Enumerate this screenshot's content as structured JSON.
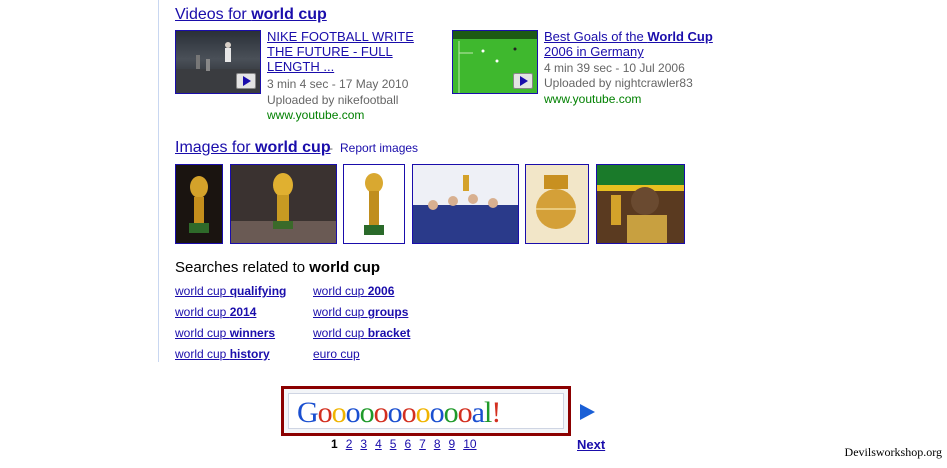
{
  "videos": {
    "title_prefix": "Videos for ",
    "title_query": "world cup",
    "items": [
      {
        "title": "NIKE FOOTBALL WRITE THE FUTURE - FULL LENGTH ...",
        "meta": "3 min 4 sec - 17 May 2010",
        "uploader": "Uploaded by nikefootball",
        "url": "www.youtube.com"
      },
      {
        "title_prefix": "Best Goals of the ",
        "title_bold": "World Cup",
        "title_suffix": " 2006 in Germany",
        "meta": "4 min 39 sec - 10 Jul 2006",
        "uploader": "Uploaded by nightcrawler83",
        "url": "www.youtube.com"
      }
    ]
  },
  "images": {
    "title_prefix": "Images for ",
    "title_query": "world cup",
    "separator": " - ",
    "report_label": "Report images"
  },
  "related": {
    "title_prefix": "Searches related to ",
    "title_query": "world cup",
    "col1": [
      {
        "plain": "world cup ",
        "bold": "qualifying"
      },
      {
        "plain": "world cup ",
        "bold": "2014"
      },
      {
        "plain": "world cup ",
        "bold": "winners"
      },
      {
        "plain": "world cup ",
        "bold": "history"
      }
    ],
    "col2": [
      {
        "plain": "world cup ",
        "bold": "2006"
      },
      {
        "plain": "world cup ",
        "bold": "groups"
      },
      {
        "plain": "world cup ",
        "bold": "bracket"
      },
      {
        "plain": "euro cup",
        "bold": ""
      }
    ]
  },
  "pagination": {
    "logo_text": "Goooooooooooal!",
    "pages": [
      "1",
      "2",
      "3",
      "4",
      "5",
      "6",
      "7",
      "8",
      "9",
      "10"
    ],
    "current": "1",
    "next_label": "Next"
  },
  "watermark": "Devilsworkshop.org",
  "colors": {
    "link": "#1a0dab",
    "url_green": "#008000",
    "logo_border": "#8b0000"
  }
}
